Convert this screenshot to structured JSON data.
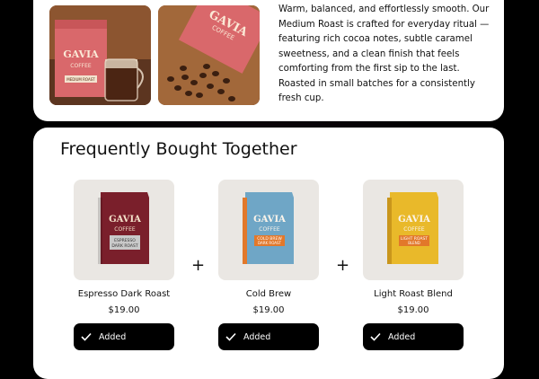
{
  "top": {
    "photo1_brand": "GAVIA",
    "photo1_sub": "COFFEE",
    "photo1_label": "MEDIUM ROAST",
    "photo2_brand": "GAVIA",
    "photo2_sub": "COFFEE",
    "description": "Warm, balanced, and effortlessly smooth. Our Medium Roast is crafted for everyday ritual — featuring rich cocoa notes, subtle caramel sweetness, and a clean finish that feels comforting from the first sip to the last. Roasted in small batches for a consistently fresh cup."
  },
  "fbt": {
    "title": "Frequently Bought Together",
    "plus": "+",
    "products": [
      {
        "name": "Espresso Dark Roast",
        "price": "$19.00",
        "button": "Added",
        "brand": "GAVIA",
        "sub": "COFFEE",
        "label_line1": "ESPRESSO",
        "label_line2": "DARK ROAST",
        "bag_color": "#7a1f2b",
        "label_color": "#c9c9c9"
      },
      {
        "name": "Cold Brew",
        "price": "$19.00",
        "button": "Added",
        "brand": "GAVIA",
        "sub": "COFFEE",
        "label_line1": "COLD BREW",
        "label_line2": "DARK ROAST",
        "bag_color": "#6fa6c6",
        "label_color": "#e2782a"
      },
      {
        "name": "Light Roast Blend",
        "price": "$19.00",
        "button": "Added",
        "brand": "GAVIA",
        "sub": "COFFEE",
        "label_line1": "LIGHT ROAST",
        "label_line2": "BLEND",
        "bag_color": "#e9b92a",
        "label_color": "#e2782a"
      }
    ]
  }
}
